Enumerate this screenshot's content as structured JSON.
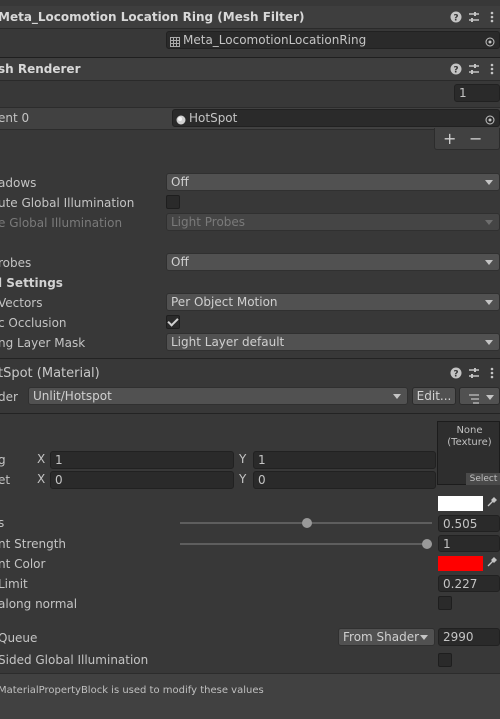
{
  "mesh_filter": {
    "title": "Meta_Locomotion Location Ring (Mesh Filter)",
    "mesh_value": "Meta_LocomotionLocationRing"
  },
  "mesh_renderer": {
    "title": "Mesh Renderer",
    "title_visible": "sh Renderer",
    "materials_count": "1",
    "element0_label": "ent 0",
    "element0_value": "HotSpot",
    "add_label": "+",
    "remove_label": "−",
    "cast_shadows_label": "adows",
    "cast_shadows_value": "Off",
    "contribute_gi_label": "ute Global Illumination",
    "receive_gi_label": "e Global Illumination",
    "receive_gi_value": "Light Probes",
    "probes_label": "robes",
    "probes_value": "Off",
    "additional_settings_label": "l Settings",
    "motion_vectors_label": "Vectors",
    "motion_vectors_value": "Per Object Motion",
    "dynamic_occlusion_label": "c Occlusion",
    "rendering_layer_label": "ng Layer Mask",
    "rendering_layer_value": "Light Layer default"
  },
  "material": {
    "title": "tSpot (Material)",
    "shader_label": "der",
    "shader_value": "Unlit/Hotspot",
    "edit_label": "Edit...",
    "texture_none": "None",
    "texture_type": "(Texture)",
    "texture_select": "Select",
    "tiling_label": "g",
    "offset_label": "et",
    "x_label": "X",
    "y_label": "Y",
    "tiling_x": "1",
    "tiling_y": "1",
    "offset_x": "0",
    "offset_y": "0",
    "prop1_label": "s",
    "prop1_value": "0.505",
    "prop1_level": 0.505,
    "prop2_label": "nt Strength",
    "prop2_value": "1",
    "prop2_level": 1.0,
    "prop3_label": "nt Color",
    "prop4_label": "Limit",
    "prop4_value": "0.227",
    "prop5_label": "along normal",
    "render_queue_label": "Queue",
    "render_queue_mode": "From Shader",
    "render_queue_value": "2990",
    "double_sided_gi_label": "Sided Global Illumination",
    "footer_text": "MaterialPropertyBlock is used to modify these values"
  },
  "colors": {
    "main_color": "#ffffff",
    "rim_color": "#ff0000"
  }
}
